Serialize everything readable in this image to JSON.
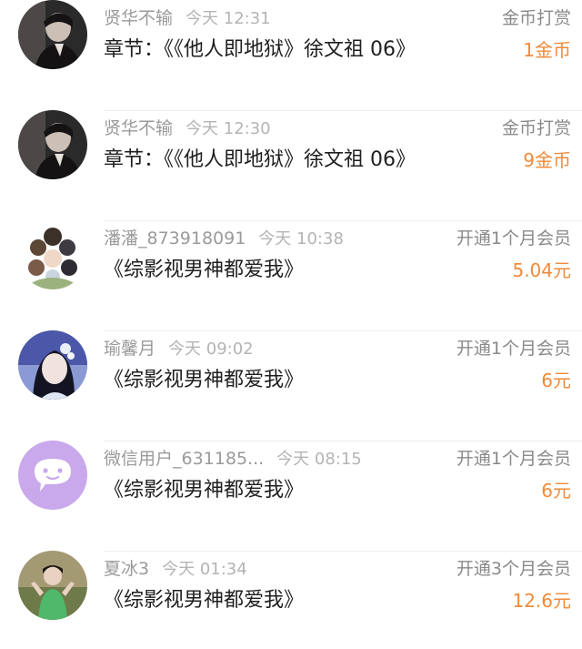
{
  "colors": {
    "accent_orange": "#f08a3a",
    "name_gray": "#9a9a9a",
    "time_gray": "#b4b4b4",
    "title_black": "#1f1f1f",
    "wechat_purple": "#c9a8ec"
  },
  "records": [
    {
      "avatar_icon": "user-photo-avatar",
      "name": "贤华不输",
      "time": "今天 12:31",
      "title": "章节：《《他人即地狱》徐文祖 06》",
      "type": "金币打赏",
      "amount": "1金币"
    },
    {
      "avatar_icon": "user-photo-avatar",
      "name": "贤华不输",
      "time": "今天 12:30",
      "title": "章节：《《他人即地狱》徐文祖 06》",
      "type": "金币打赏",
      "amount": "9金币"
    },
    {
      "avatar_icon": "illustration-avatar",
      "name": "潘潘_873918091",
      "time": "今天 10:38",
      "title": "《综影视男神都爱我》",
      "type": "开通1个月会员",
      "amount": "5.04元"
    },
    {
      "avatar_icon": "user-photo-avatar",
      "name": "瑜馨月",
      "time": "今天 09:02",
      "title": "《综影视男神都爱我》",
      "type": "开通1个月会员",
      "amount": "6元"
    },
    {
      "avatar_icon": "wechat-default-avatar-icon",
      "name": "微信用户_631185...",
      "time": "今天 08:15",
      "title": "《综影视男神都爱我》",
      "type": "开通1个月会员",
      "amount": "6元"
    },
    {
      "avatar_icon": "user-photo-avatar",
      "name": "夏冰3",
      "time": "今天 01:34",
      "title": "《综影视男神都爱我》",
      "type": "开通3个月会员",
      "amount": "12.6元"
    }
  ]
}
